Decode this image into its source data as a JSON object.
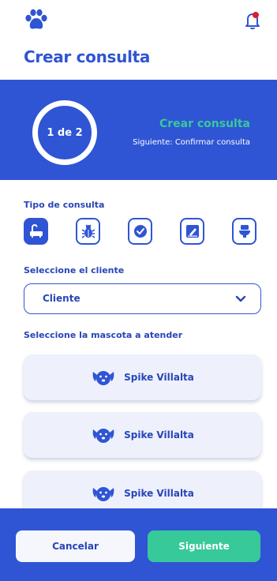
{
  "header": {
    "logo_icon": "paw-icon",
    "notification_icon": "bell-icon",
    "title": "Crear consulta"
  },
  "colors": {
    "primary": "#2f55d4",
    "accent": "#37c99a",
    "text_dark_blue": "#2845b8",
    "card_bg": "#eef1fb",
    "notification_dot": "#e11d2a"
  },
  "progress": {
    "step_label": "1 de 2",
    "current_step": 1,
    "total_steps": 2,
    "title": "Crear consulta",
    "next_label": "Siguiente: Confirmar consulta"
  },
  "consultation_type": {
    "label": "Tipo de consulta",
    "options": [
      {
        "icon": "bathtub-icon",
        "selected": true
      },
      {
        "icon": "bug-icon",
        "selected": false
      },
      {
        "icon": "check-circle-icon",
        "selected": false
      },
      {
        "icon": "edit-document-icon",
        "selected": false
      },
      {
        "icon": "toilet-icon",
        "selected": false
      }
    ]
  },
  "client": {
    "label": "Seleccione el cliente",
    "selected": "Cliente"
  },
  "pets": {
    "label": "Seleccione la mascota a atender",
    "items": [
      {
        "name": "Spike Villalta",
        "icon": "dog-icon"
      },
      {
        "name": "Spike Villalta",
        "icon": "dog-icon"
      },
      {
        "name": "Spike Villalta",
        "icon": "dog-icon"
      }
    ]
  },
  "footer": {
    "cancel_label": "Cancelar",
    "next_label": "Siguiente"
  }
}
